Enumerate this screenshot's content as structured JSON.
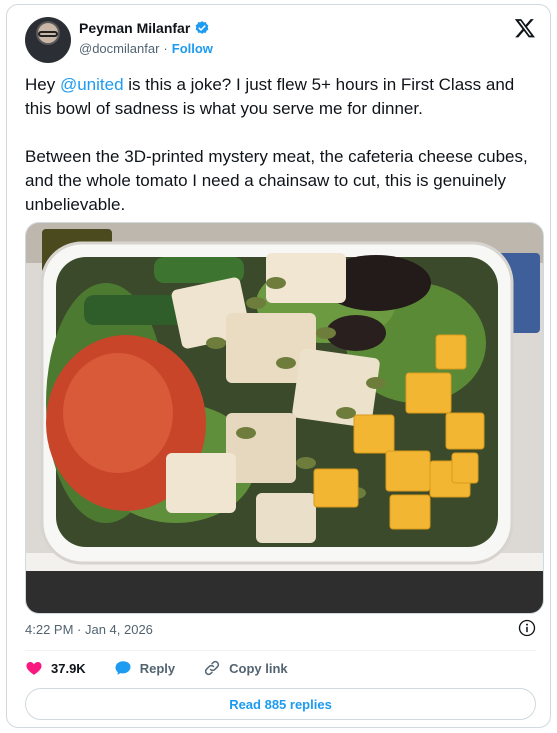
{
  "author": {
    "display_name": "Peyman Milanfar",
    "handle": "@docmilanfar",
    "separator": "·",
    "follow_label": "Follow"
  },
  "tweet": {
    "part1_prefix": "Hey ",
    "mention": "@united",
    "part1_suffix": " is this a joke? I just flew 5+ hours in First Class and this bowl of sadness is what you serve me for dinner.",
    "part2": "Between the 3D-printed mystery meat, the cafeteria cheese cubes, and the whole tomato I need a chainsaw to cut, this is genuinely unbelievable."
  },
  "timestamp": "4:22 PM · Jan 4, 2026",
  "actions": {
    "likes": "37.9K",
    "reply": "Reply",
    "copy_link": "Copy link"
  },
  "read_replies": "Read 885 replies",
  "colors": {
    "accent": "#1d9bf0",
    "like": "#f91880",
    "muted": "#536471"
  },
  "icons": [
    "verified-badge-icon",
    "x-logo-icon",
    "info-icon",
    "heart-icon",
    "reply-icon",
    "link-icon"
  ]
}
